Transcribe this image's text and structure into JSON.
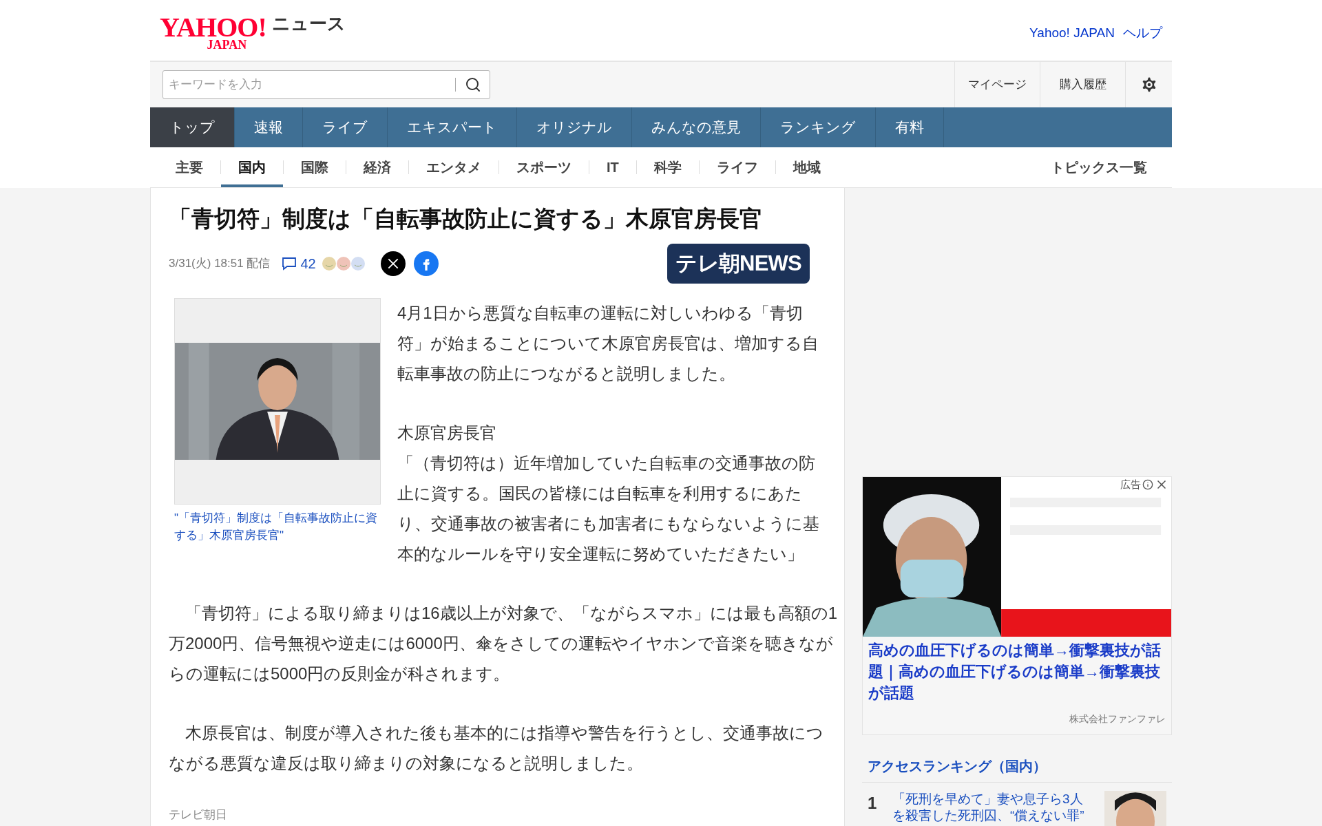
{
  "header": {
    "logo": "YAHOO!",
    "logo_sub": "JAPAN",
    "service": "ニュース",
    "links": [
      "Yahoo! JAPAN",
      "ヘルプ"
    ]
  },
  "search": {
    "placeholder": "キーワードを入力"
  },
  "account_links": [
    "マイページ",
    "購入履歴"
  ],
  "nav_tabs": [
    {
      "label": "トップ",
      "selected": true
    },
    {
      "label": "速報",
      "selected": false
    },
    {
      "label": "ライブ",
      "selected": false
    },
    {
      "label": "エキスパート",
      "selected": false
    },
    {
      "label": "オリジナル",
      "selected": false
    },
    {
      "label": "みんなの意見",
      "selected": false
    },
    {
      "label": "ランキング",
      "selected": false
    },
    {
      "label": "有料",
      "selected": false
    }
  ],
  "category_tabs": [
    {
      "label": "主要",
      "selected": false
    },
    {
      "label": "国内",
      "selected": true
    },
    {
      "label": "国際",
      "selected": false
    },
    {
      "label": "経済",
      "selected": false
    },
    {
      "label": "エンタメ",
      "selected": false
    },
    {
      "label": "スポーツ",
      "selected": false
    },
    {
      "label": "IT",
      "selected": false
    },
    {
      "label": "科学",
      "selected": false
    },
    {
      "label": "ライフ",
      "selected": false
    },
    {
      "label": "地域",
      "selected": false
    }
  ],
  "topics_link": "トピックス一覧",
  "article": {
    "title": "「青切符」制度は「自転事故防止に資する」木原官房長官",
    "date": "3/31(火) 18:51 配信",
    "comment_count": "42",
    "publisher_logo": "テレ朝NEWS",
    "image_caption": "\"「青切符」制度は「自転事故防止に資する」木原官房長官\"",
    "lead": "4月1日から悪質な自転車の運転に対しいわゆる「青切符」が始まることについて木原官房長官は、増加する自転車事故の防止につながると説明しました。",
    "speaker": "木原官房長官",
    "quote": "「（青切符は）近年増加していた自転車の交通事故の防止に資する。国民の皆様には自転車を利用するにあたり、交通事故の被害者にも加害者にもならないように基本的なルールを守り安全運転に努めていただきたい」",
    "paragraphs": [
      "　「青切符」による取り締まりは16歳以上が対象で、「ながらスマホ」には最も高額の1万2000円、信号無視や逆走には6000円、傘をさしての運転やイヤホンで音楽を聴きながらの運転には5000円の反則金が科されます。",
      "　木原長官は、制度が導入された後も基本的には指導や警告を行うとし、交通事故につながる悪質な違反は取り締まりの対象になると説明しました。"
    ],
    "source": "テレビ朝日"
  },
  "ad": {
    "label": "広告",
    "headline": "高めの血圧下げるのは簡単→衝撃裏技が話題｜高めの血圧下げるのは簡単→衝撃裏技が話題",
    "advertiser": "株式会社ファンファレ"
  },
  "ranking": {
    "title": "アクセスランキング（国内）",
    "items": [
      {
        "rank": "1",
        "title": "「死刑を早めて」妻や息子ら3人を殺害した死刑囚、“償えない罪”"
      }
    ]
  }
}
